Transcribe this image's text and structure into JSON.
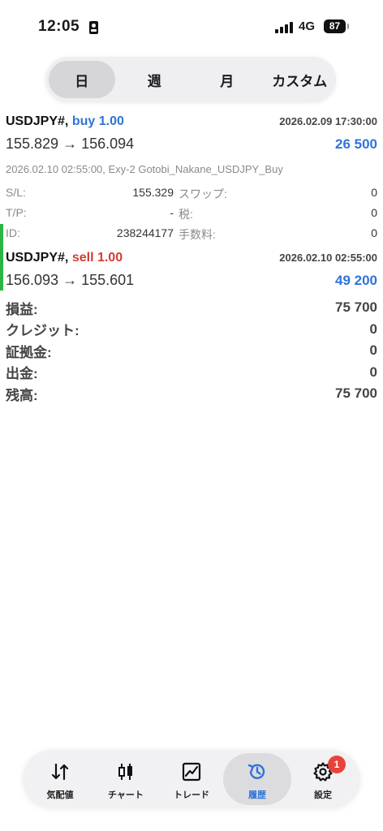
{
  "status_bar": {
    "time": "12:05",
    "network": "4G",
    "battery": "87"
  },
  "period_tabs": [
    {
      "label": "日",
      "active": true
    },
    {
      "label": "週",
      "active": false
    },
    {
      "label": "月",
      "active": false
    },
    {
      "label": "カスタム",
      "active": false
    }
  ],
  "deals": [
    {
      "symbol": "USDJPY#,",
      "side": "buy 1.00",
      "time": "2026.02.09 17:30:00",
      "prices": "155.829 → 156.094",
      "profit": "26 500",
      "comment": "2026.02.10 02:55:00, Exy-2 Gotobi_Nakane_USDJPY_Buy",
      "details": [
        {
          "k1": "S/L:",
          "v1": "155.329",
          "k2": "スワップ:",
          "v2": "0"
        },
        {
          "k1": "T/P:",
          "v1": "-",
          "k2": "税:",
          "v2": "0"
        },
        {
          "k1": "ID:",
          "v1": "238244177",
          "k2": "手数料:",
          "v2": "0"
        }
      ]
    },
    {
      "symbol": "USDJPY#,",
      "side": "sell 1.00",
      "time": "2026.02.10 02:55:00",
      "prices": "156.093 → 155.601",
      "profit": "49 200"
    }
  ],
  "summary": [
    {
      "label": "損益:",
      "value": "75 700"
    },
    {
      "label": "クレジット:",
      "value": "0"
    },
    {
      "label": "証拠金:",
      "value": "0"
    },
    {
      "label": "出金:",
      "value": "0"
    },
    {
      "label": "残高:",
      "value": "75 700"
    }
  ],
  "bottom_nav": [
    {
      "label": "気配値",
      "icon": "arrows-updown-icon",
      "active": false
    },
    {
      "label": "チャート",
      "icon": "candlestick-icon",
      "active": false
    },
    {
      "label": "トレード",
      "icon": "trade-chart-icon",
      "active": false
    },
    {
      "label": "履歴",
      "icon": "history-icon",
      "active": true
    },
    {
      "label": "設定",
      "icon": "gear-icon",
      "active": false
    }
  ],
  "settings_badge": "1",
  "colors": {
    "buy": "#2f73d8",
    "sell": "#d43b2f",
    "accent": "#2f73d8",
    "badge": "#e8423a",
    "sell_marker": "#2fb344"
  }
}
